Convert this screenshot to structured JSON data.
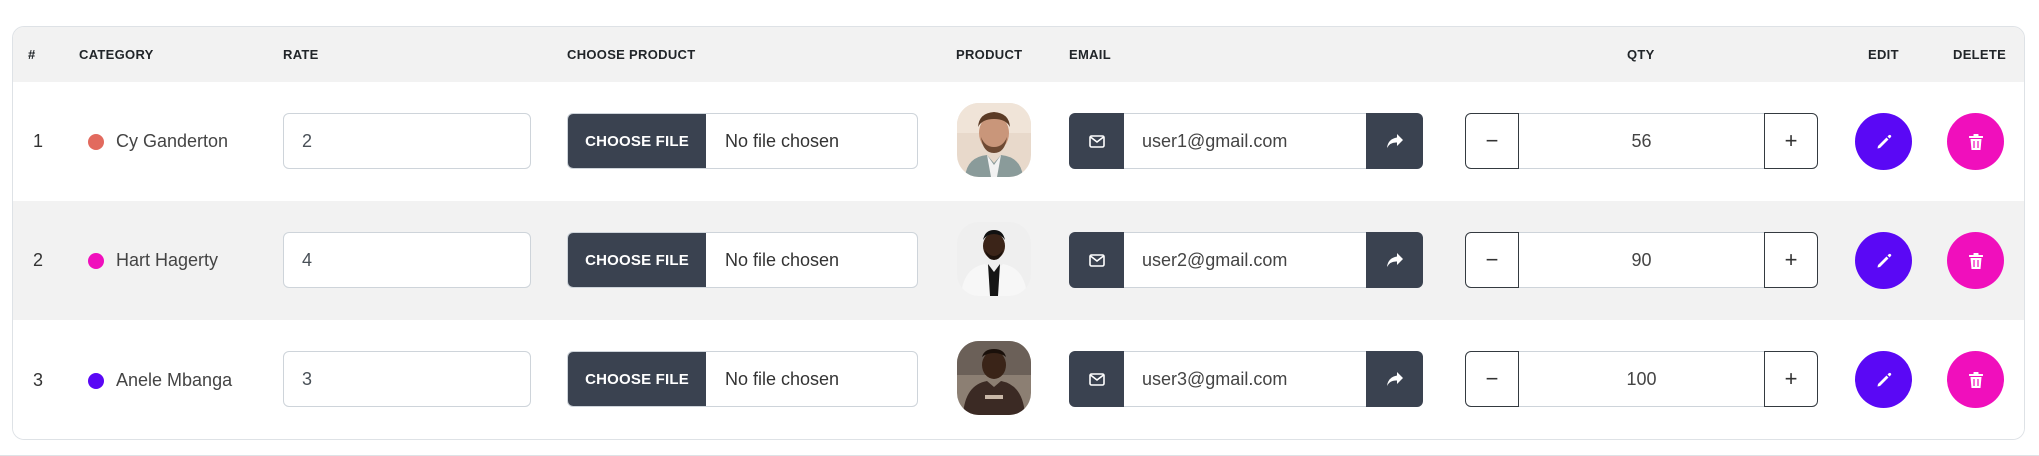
{
  "headers": {
    "index": "#",
    "category": "CATEGORY",
    "rate": "RATE",
    "choose_product": "CHOOSE PRODUCT",
    "product": "PRODUCT",
    "email": "EMAIL",
    "qty": "QTY",
    "edit": "EDIT",
    "delete": "DELETE"
  },
  "rows": [
    {
      "index": "1",
      "category": "Cy Ganderton",
      "dot_color": "#e26a5e",
      "rate": "2",
      "file_button": "CHOOSE FILE",
      "file_status": "No file chosen",
      "avatar": "avatar-man-beard",
      "email": "user1@gmail.com",
      "qty": "56",
      "minus": "−",
      "plus": "+"
    },
    {
      "index": "2",
      "category": "Hart Hagerty",
      "dot_color": "#f00fbc",
      "rate": "4",
      "file_button": "CHOOSE FILE",
      "file_status": "No file chosen",
      "avatar": "avatar-man-blazer",
      "email": "user2@gmail.com",
      "qty": "90",
      "minus": "−",
      "plus": "+"
    },
    {
      "index": "3",
      "category": "Anele Mbanga",
      "dot_color": "#5a08f5",
      "rate": "3",
      "file_button": "CHOOSE FILE",
      "file_status": "No file chosen",
      "avatar": "avatar-man-tshirt",
      "email": "user3@gmail.com",
      "qty": "100",
      "minus": "−",
      "plus": "+"
    }
  ],
  "colors": {
    "dark_button": "#3a4250",
    "edit_button": "#5a08f5",
    "delete_button": "#f00fbc",
    "striped_row": "#f2f2f2"
  },
  "icons": {
    "email": "envelope-icon",
    "send": "share-arrow-icon",
    "edit": "pencil-icon",
    "delete": "trash-icon"
  }
}
